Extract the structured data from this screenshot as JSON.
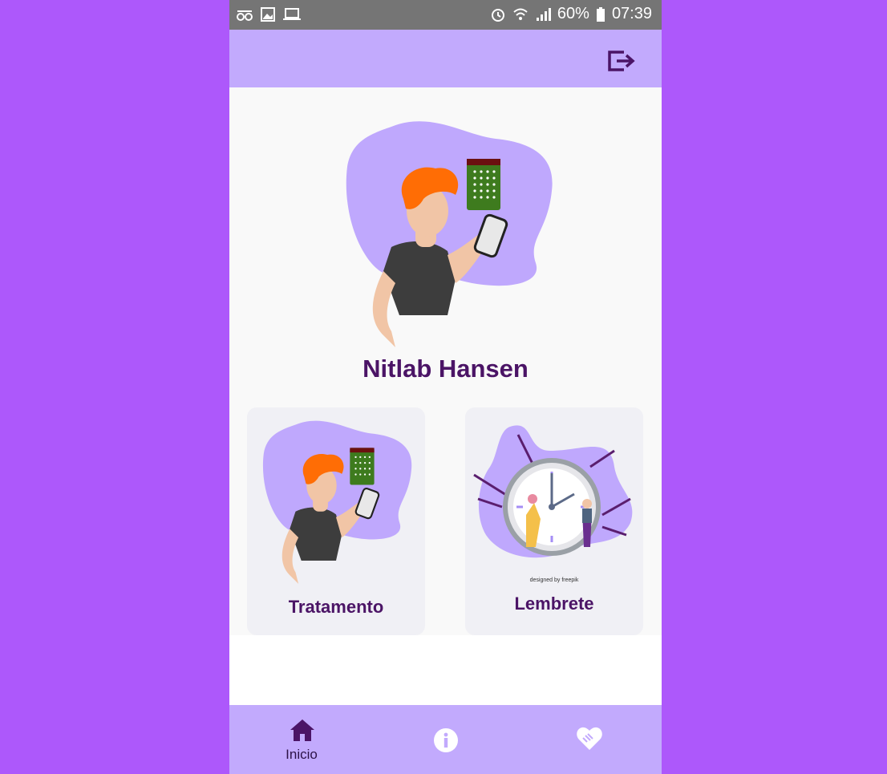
{
  "status_bar": {
    "battery": "60%",
    "time": "07:39",
    "left_icons": [
      "signal-glasses-icon",
      "image-icon",
      "laptop-icon"
    ],
    "right_icons": [
      "alarm-icon",
      "wifi-icon",
      "cell-signal-icon",
      "battery-icon"
    ]
  },
  "app_bar": {
    "action_icon": "logout-icon",
    "color": "#c2aafd"
  },
  "profile": {
    "name": "Nitlab Hansen"
  },
  "cards": [
    {
      "label": "Tratamento",
      "icon": "treatment-illustration"
    },
    {
      "label": "Lembrete",
      "icon": "clock-illustration",
      "credit": "designed by freepik"
    }
  ],
  "bottom_nav": {
    "items": [
      {
        "label": "Inicio",
        "icon": "home-icon",
        "selected": true
      },
      {
        "label": "",
        "icon": "info-icon",
        "selected": false
      },
      {
        "label": "",
        "icon": "handshake-heart-icon",
        "selected": false
      }
    ]
  },
  "colors": {
    "page_background": "#ad58fb",
    "accent": "#c2aafd",
    "title_text": "#4b1466",
    "status_bar": "#757575"
  }
}
